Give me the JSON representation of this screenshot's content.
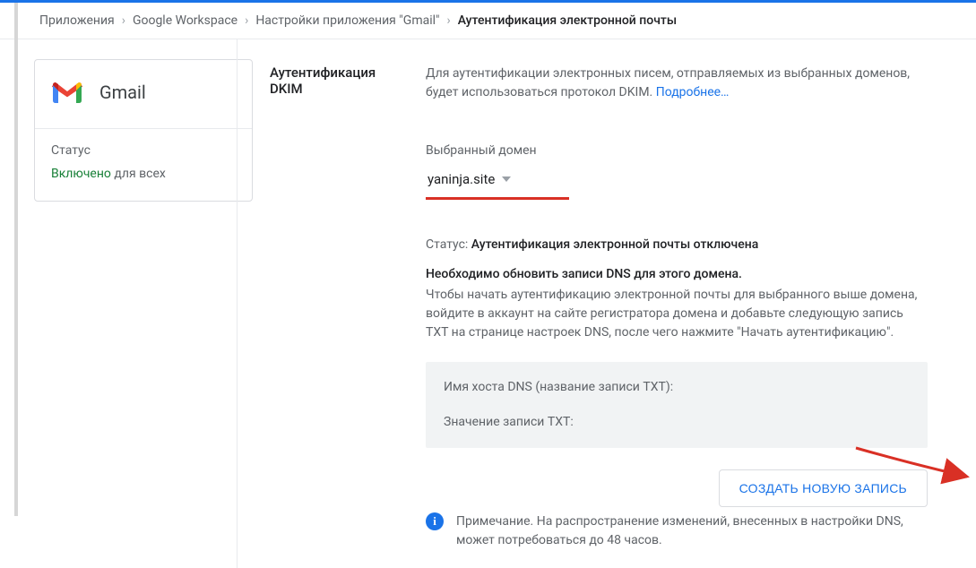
{
  "breadcrumb": {
    "items": [
      "Приложения",
      "Google Workspace",
      "Настройки приложения \"Gmail\""
    ],
    "current": "Аутентификация электронной почты"
  },
  "sidebar": {
    "app_name": "Gmail",
    "status_label": "Статус",
    "status_value": "Включено",
    "status_scope": "для всех"
  },
  "main": {
    "section_title": "Аутентификация DKIM",
    "intro": "Для аутентификации электронных писем, отправляемых из выбранных доменов, будет использоваться протокол DKIM.",
    "more": "Подробнее…",
    "domain_label": "Выбранный домен",
    "domain_value": "yaninja.site",
    "status_prefix": "Статус:",
    "status_text": "Аутентификация электронной почты отключена",
    "dns_bold": "Необходимо обновить записи DNS для этого домена.",
    "dns_desc": "Чтобы начать аутентификацию электронной почты для выбранного выше домена, войдите в аккаунт на сайте регистратора домена и добавьте следующую запись TXT на странице настроек DNS, после чего нажмите \"Начать аутентификацию\".",
    "box_host": "Имя хоста DNS (название записи TXT):",
    "box_value": "Значение записи TXT:",
    "button": "СОЗДАТЬ НОВУЮ ЗАПИСЬ",
    "note": "Примечание. На распространение изменений, внесенных в настройки DNS, может потребоваться до 48 часов."
  }
}
